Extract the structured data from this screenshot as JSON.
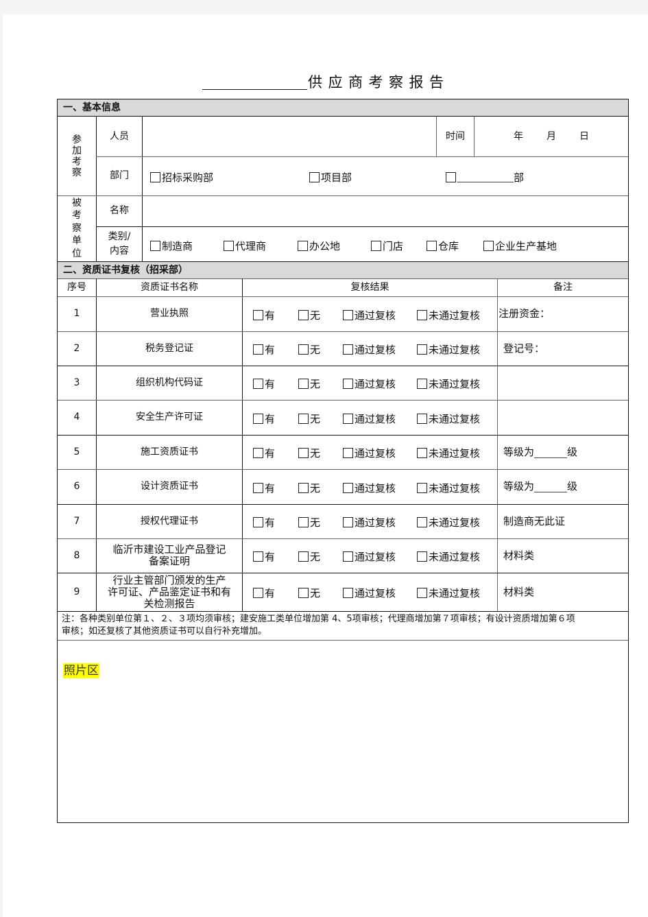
{
  "title": {
    "blank_prefix": "",
    "text": "供应商考察报告"
  },
  "section1": {
    "heading": "一、基本信息",
    "participants_group_label": "参加考察",
    "personnel_label": "人员",
    "personnel_value": "",
    "time_label": "时间",
    "date": {
      "year_label": "年",
      "month_label": "月",
      "day_label": "日"
    },
    "department_label": "部门",
    "department_options": [
      {
        "label": "招标采购部",
        "checked": false
      },
      {
        "label": "项目部",
        "checked": false
      },
      {
        "label": "部",
        "checked": false,
        "has_blank": true
      }
    ],
    "inspected_group_label": "被考察单位",
    "name_label": "名称",
    "name_value": "",
    "category_label_line1": "类别/",
    "category_label_line2": "内容",
    "category_options": [
      {
        "label": "制造商",
        "checked": false
      },
      {
        "label": "代理商",
        "checked": false
      },
      {
        "label": "办公地",
        "checked": false
      },
      {
        "label": "门店",
        "checked": false
      },
      {
        "label": "仓库",
        "checked": false
      },
      {
        "label": "企业生产基地",
        "checked": false
      }
    ]
  },
  "section2": {
    "heading": "二、资质证书复核（招采部）",
    "columns": {
      "no": "序号",
      "name": "资质证书名称",
      "result": "复核结果",
      "remark": "备注"
    },
    "result_options": [
      "有",
      "无",
      "通过复核",
      "未通过复核"
    ],
    "rows": [
      {
        "no": "1",
        "name": "营业执照",
        "remark": "注册资金："
      },
      {
        "no": "2",
        "name": "税务登记证",
        "remark": "登记号："
      },
      {
        "no": "3",
        "name": "组织机构代码证",
        "remark": ""
      },
      {
        "no": "4",
        "name": "安全生产许可证",
        "remark": ""
      },
      {
        "no": "5",
        "name": "施工资质证书",
        "remark_prefix": "等级为",
        "remark_suffix": "级"
      },
      {
        "no": "6",
        "name": "设计资质证书",
        "remark_prefix": "等级为",
        "remark_suffix": "级"
      },
      {
        "no": "7",
        "name": "授权代理证书",
        "remark": "制造商无此证"
      },
      {
        "no": "8",
        "name_line1": "临沂市建设工业产品登记",
        "name_line2": "备案证明",
        "remark": "材料类"
      },
      {
        "no": "9",
        "name_line1": "行业主管部门颁发的生产",
        "name_line2": "许可证、产品鉴定证书和有",
        "name_line3": "关检测报告",
        "remark": "材料类"
      }
    ],
    "note_line1": "注：各种类别单位第１、２、３项均须审核；建安施工类单位增加第 4、5项审核；代理商增加第７项审核；有设计资质增加第６项",
    "note_line2": "审核；如还复核了其他资质证书可以自行补充增加。"
  },
  "photo_area": {
    "label": "照片区",
    "highlight_color": "#ffff00"
  },
  "colors": {
    "section_header_bg": "#d9d9d9",
    "page_bg": "#f4f4f4"
  }
}
